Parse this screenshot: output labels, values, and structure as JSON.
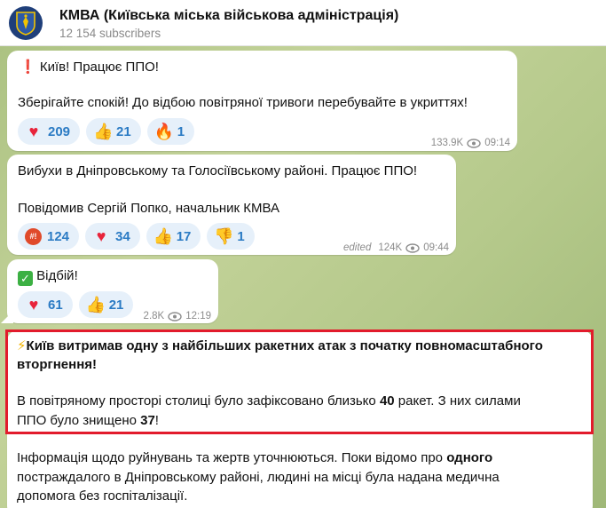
{
  "channel": {
    "title": "КМВА (Київська міська військова адміністрація)",
    "subscribers": "12 154 subscribers"
  },
  "messages": [
    {
      "lines": [
        "❗ Київ! Працює ППО!",
        "Зберігайте спокій! До відбою  повітряної тривоги перебувайте в укриттях!"
      ],
      "reactions": [
        {
          "emoji": "heart",
          "count": "209"
        },
        {
          "emoji": "thumbs-up",
          "count": "21"
        },
        {
          "emoji": "fire",
          "count": "1"
        }
      ],
      "views": "133.9K",
      "time": "09:14"
    },
    {
      "lines": [
        "Вибухи в Дніпровському та Голосіївському районі. Працює ППО!",
        "Повідомив Сергій Попко, начальник КМВА"
      ],
      "reactions": [
        {
          "emoji": "angry-face",
          "count": "124"
        },
        {
          "emoji": "heart",
          "count": "34"
        },
        {
          "emoji": "thumbs-up",
          "count": "17"
        },
        {
          "emoji": "thumbs-down",
          "count": "1"
        }
      ],
      "edited": "edited",
      "views": "124K",
      "time": "09:44"
    },
    {
      "line": "Відбій!",
      "reactions": [
        {
          "emoji": "heart",
          "count": "61"
        },
        {
          "emoji": "thumbs-up",
          "count": "21"
        }
      ],
      "views": "2.8K",
      "time": "12:19"
    },
    {
      "headline_line1": "Київ витримав одну з найбільших ракетних атак з початку повномасштабного",
      "headline_line2": "вторгнення!",
      "p1_line1_a": "В повітряному просторі столиці було зафіксовано близько ",
      "p1_line1_num": "40",
      "p1_line1_b": " ракет. З них силами",
      "p1_line2_a": "ППО було знищено ",
      "p1_line2_num": "37",
      "p1_line2_b": "!",
      "p2_line1_a": "Інформація щодо руйнувань та жертв уточнюються. Поки відомо про ",
      "p2_line1_bold": "одного",
      "p2_line2": "постраждалого в Дніпровському районі, людині на місці була надана медична",
      "p2_line3": "допомога без госпіталізації."
    }
  ],
  "colors": {
    "accent": "#2b7bc4",
    "highlight_frame": "#e21b2c",
    "reaction_bg": "#e6f0fa"
  }
}
